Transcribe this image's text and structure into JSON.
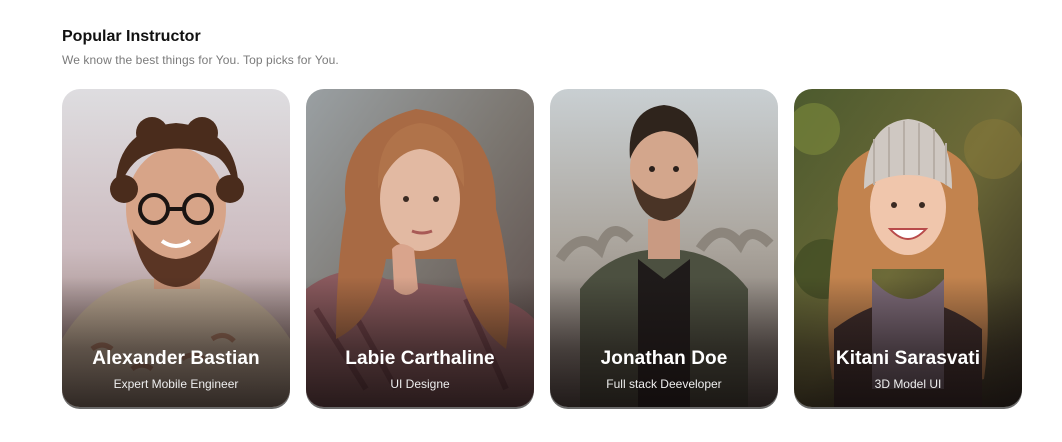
{
  "section": {
    "title": "Popular Instructor",
    "subtitle": "We know the best things for You.  Top picks for You."
  },
  "instructors": [
    {
      "name": "Alexander Bastian",
      "role": "Expert Mobile Engineer"
    },
    {
      "name": "Labie Carthaline",
      "role": "UI Designe"
    },
    {
      "name": "Jonathan Doe",
      "role": "Full stack Deeveloper"
    },
    {
      "name": "Kitani Sarasvati",
      "role": "3D Model UI"
    }
  ]
}
